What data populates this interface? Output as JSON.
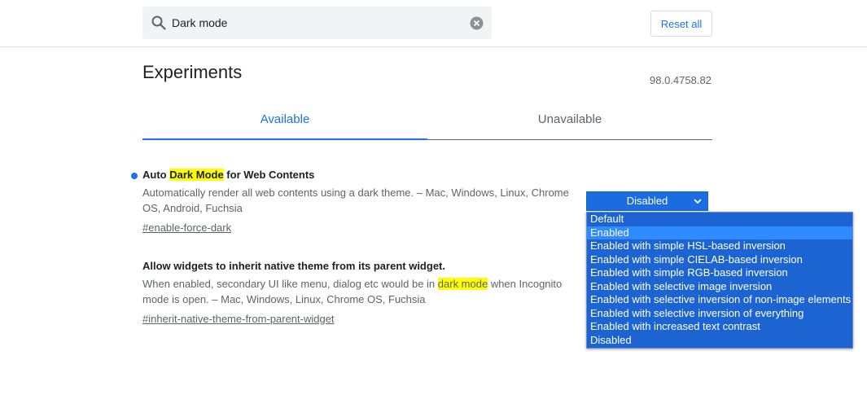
{
  "search": {
    "value": "Dark mode",
    "reset_label": "Reset all"
  },
  "page": {
    "title": "Experiments",
    "version": "98.0.4758.82"
  },
  "tabs": [
    {
      "label": "Available",
      "active": true
    },
    {
      "label": "Unavailable",
      "active": false
    }
  ],
  "experiments": [
    {
      "title_before": "Auto ",
      "title_highlight": "Dark Mode",
      "title_after": " for Web Contents",
      "description": "Automatically render all web contents using a dark theme. – Mac, Windows, Linux, Chrome OS, Android, Fuchsia",
      "link": "#enable-force-dark",
      "selected": "Disabled",
      "modified": true
    },
    {
      "title": "Allow widgets to inherit native theme from its parent widget.",
      "desc_before": "When enabled, secondary UI like menu, dialog etc would be in ",
      "desc_highlight": "dark mode",
      "desc_after": " when Incognito mode is open. – Mac, Windows, Linux, Chrome OS, Fuchsia",
      "link": "#inherit-native-theme-from-parent-widget"
    }
  ],
  "dropdown_options": [
    "Default",
    "Enabled",
    "Enabled with simple HSL-based inversion",
    "Enabled with simple CIELAB-based inversion",
    "Enabled with simple RGB-based inversion",
    "Enabled with selective image inversion",
    "Enabled with selective inversion of non-image elements",
    "Enabled with selective inversion of everything",
    "Enabled with increased text contrast",
    "Disabled"
  ],
  "dropdown_highlighted": "Enabled",
  "colors": {
    "accent": "#1a73e8",
    "highlight": "#ffff00",
    "select_bg": "#1a6de0",
    "dropdown_bg": "#1c64d2",
    "dropdown_hover": "#2f8bff"
  }
}
